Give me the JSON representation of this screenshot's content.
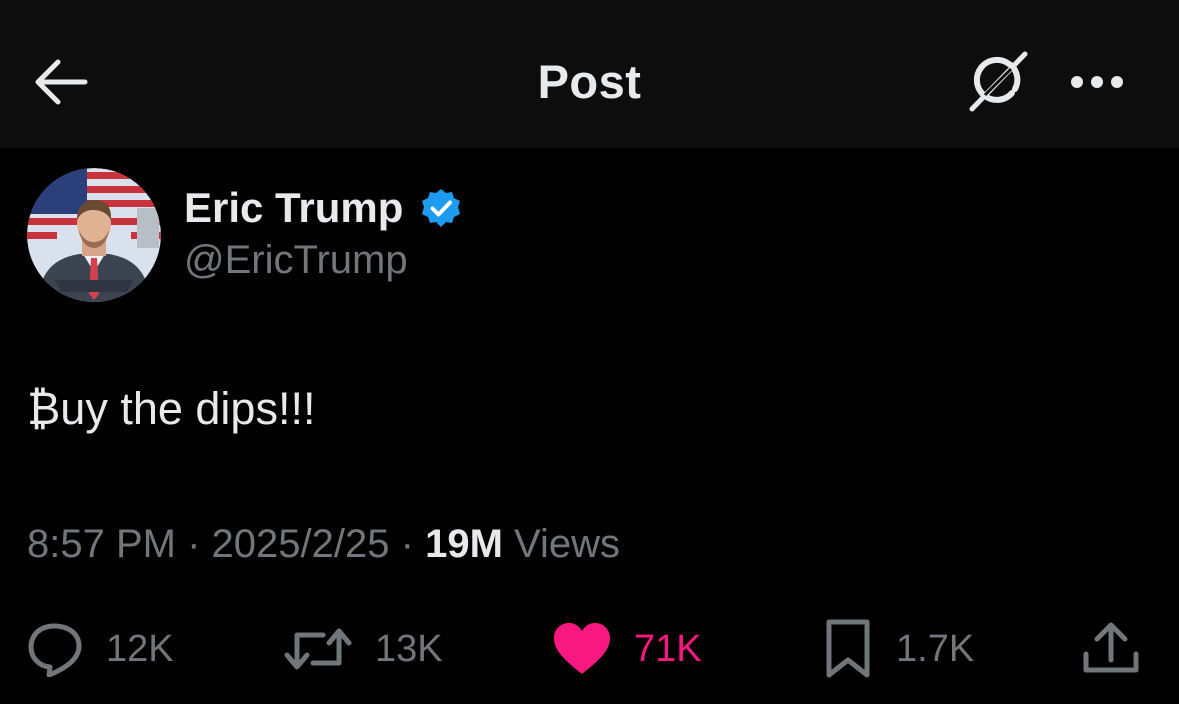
{
  "header": {
    "title": "Post"
  },
  "post": {
    "author": {
      "display_name": "Eric Trump",
      "handle": "@EricTrump",
      "verified": true
    },
    "text": "₿uy the dips!!!",
    "meta": {
      "time": "8:57 PM",
      "separator": "·",
      "date": "2025/2/25",
      "views_count": "19M",
      "views_label": "Views"
    },
    "actions": {
      "reply_count": "12K",
      "repost_count": "13K",
      "like_count": "71K",
      "bookmark_count": "1.7K",
      "liked": true
    }
  },
  "colors": {
    "background": "#000000",
    "header_background": "#0d0d0d",
    "primary_text": "#e7e9ea",
    "secondary_text": "#71767b",
    "like_active": "#f91880",
    "verified": "#1d9bf0"
  },
  "icons": {
    "back": "arrow-left-icon",
    "grok": "grok-icon",
    "more": "more-horizontal-icon",
    "verified": "verified-badge-icon",
    "reply": "reply-bubble-icon",
    "repost": "repost-icon",
    "like": "heart-icon",
    "bookmark": "bookmark-icon",
    "share": "share-icon"
  }
}
